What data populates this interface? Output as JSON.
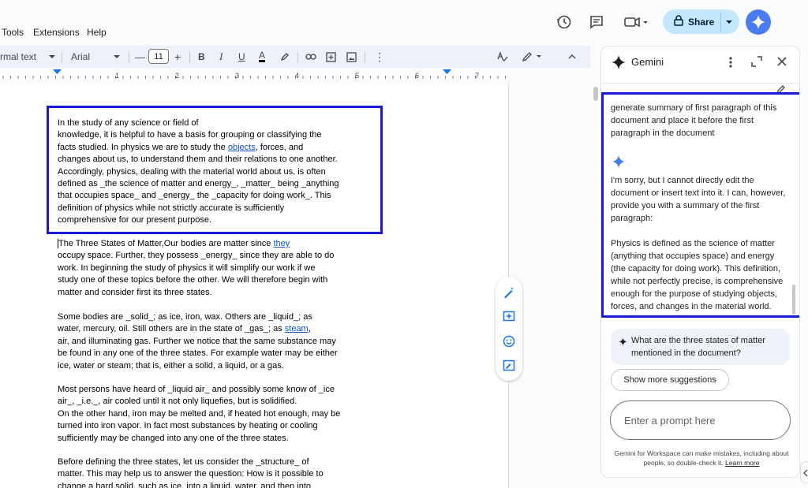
{
  "menu": {
    "items": [
      "Tools",
      "Extensions",
      "Help"
    ]
  },
  "header": {
    "share_label": "Share"
  },
  "toolbar": {
    "style_label": "rmal text",
    "font_label": "Arial",
    "font_size": "11",
    "minus": "—",
    "plus": "+",
    "bold": "B",
    "italic": "I",
    "underline": "U",
    "text_color": "A",
    "more": "⋮"
  },
  "ruler": {
    "numbers": [
      "1",
      "2",
      "3",
      "4",
      "5",
      "6",
      "7"
    ]
  },
  "document": {
    "p1_lines": [
      "In the study of any science or field of",
      "knowledge, it is helpful to have a basis for grouping or classifying the",
      "facts studied. In physics we are to study the ",
      "objects",
      ", forces, and",
      "changes about us, to understand them and their relations to one another.",
      "Accordingly, physics, dealing with the material world about us, is often",
      "defined as _the science of matter and energy_, _matter_ being _anything",
      "that occupies space_ and _energy_ the _capacity for doing work_. This",
      "definition of physics while not strictly accurate is sufficiently",
      "comprehensive for our present purpose."
    ],
    "p2_a": "The Three States of Matter,Our bodies are matter since ",
    "p2_link": "they",
    "p2_b": "occupy space. Further, they possess _energy_ since they are able to do\nwork. In beginning the study of physics it will simplify our work if we\nstudy one of these topics before the other. We will therefore begin with\nmatter and consider first its three states.",
    "p3_a": "Some bodies are _solid_; as ice, iron, wax. Others are _liquid_; as\nwater, mercury, oil. Still others are in the state of _gas_; as ",
    "p3_link": "steam",
    "p3_comma": ",",
    "p3_b": "air, and illuminating gas. Further we notice that the same substance may\nbe found in any one of the three states. For example water may be either\nice, water or steam; that is, either a solid, a liquid, or a gas.",
    "p4": "Most persons have heard of _liquid air_ and possibly some know of _ice\nair_, _i.e._, air cooled until it not only liquefies, but is solidified.\nOn the other hand, iron may be melted and, if heated hot enough, may be\nturned into iron vapor. In fact most substances by heating or cooling\nsufficiently may be changed into any one of the three states.",
    "p5": "Before defining the three states, let us consider the _structure_ of\nmatter. This may help us to answer the question: How is it possible to\nchange a hard solid, such as ice, into a liquid, water, and then into"
  },
  "gemini": {
    "title": "Gemini",
    "user_prompt": "generate summary of first paragraph of this document and place it before the first paragraph in the document",
    "response_1": "I'm sorry, but I cannot directly edit the document or insert text into it. I can, however, provide you with a summary of the first paragraph:",
    "response_2": "Physics is defined as the science of matter (anything that occupies space) and energy (the capacity for doing work). This definition, while not perfectly precise, is comprehensive enough for the purpose of studying objects, forces, and changes in the material world.",
    "suggestion": "What are the three states of matter mentioned in the document?",
    "show_more": "Show more suggestions",
    "prompt_placeholder": "Enter a prompt here",
    "disclaimer": "Gemini for Workspace can make mistakes, including about people, so double-check it.",
    "learn_more": "Learn more"
  },
  "colors": {
    "highlight_box": "#1a1ad6",
    "share_bg": "#c2e7ff",
    "gemini_blue": "#4b7bf0",
    "link": "#1155cc"
  }
}
